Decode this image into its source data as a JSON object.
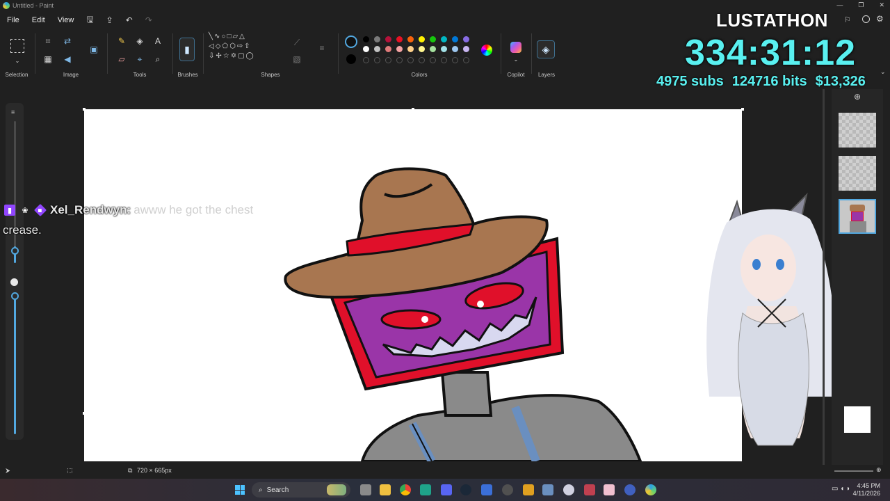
{
  "window": {
    "title": "Untitled - Paint"
  },
  "menu": {
    "file": "File",
    "edit": "Edit",
    "view": "View"
  },
  "ribbon": {
    "selection": "Selection",
    "image": "Image",
    "tools": "Tools",
    "brushes": "Brushes",
    "shapes": "Shapes",
    "colors": "Colors",
    "copilot": "Copilot",
    "layers": "Layers",
    "text_tool": "A"
  },
  "palette": {
    "row1": [
      "#000000",
      "#7a7a7a",
      "#b5123a",
      "#e81224",
      "#f7630c",
      "#fff100",
      "#16c60c",
      "#00b7c3",
      "#0078d7",
      "#886ce4"
    ],
    "row2": [
      "#ffffff",
      "#c2c2c2",
      "#e07a7a",
      "#f4a3a3",
      "#ffd08a",
      "#fff68f",
      "#a6e29f",
      "#a3e1e7",
      "#9ec8f0",
      "#c9b6f2"
    ]
  },
  "chat": {
    "user": "Xel_Rendwyn",
    "separator": ":",
    "message": "awww he got the chest",
    "continuation": "crease."
  },
  "subathon": {
    "title": "LUSTATHON",
    "timer": "334:31:12",
    "subs": "4975 subs",
    "bits": "124716 bits",
    "money": "$13,326"
  },
  "status": {
    "canvas_size": "720 × 665px"
  },
  "taskbar": {
    "search_label": "Search",
    "time": "4:45 PM",
    "date": "4/11/2026"
  },
  "colors": {
    "accent": "#52a8e0",
    "timer": "#59f0f0",
    "twitch_purple": "#9146ff"
  }
}
